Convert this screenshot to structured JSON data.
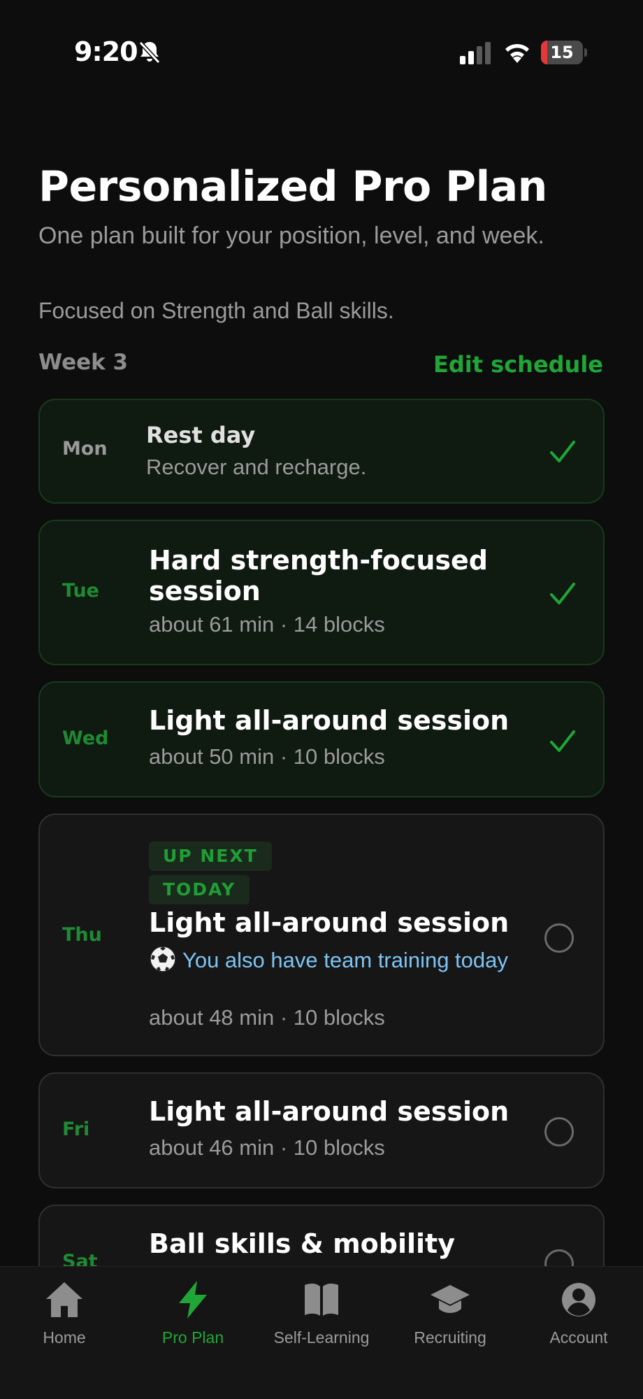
{
  "status_bar": {
    "time": "9:20",
    "battery_level": "15",
    "battery_fraction": 0.15
  },
  "header": {
    "title": "Personalized Pro Plan",
    "subtitle": "One plan built for your position, level, and week.",
    "focus": "Focused on Strength and Ball skills."
  },
  "week": {
    "label": "Week 3",
    "edit_label": "Edit schedule"
  },
  "days": [
    {
      "day": "Mon",
      "title": "Rest day",
      "meta": "Recover and recharge.",
      "status": "done"
    },
    {
      "day": "Tue",
      "title": "Hard strength-focused session",
      "meta": "about 61 min · 14 blocks",
      "status": "done"
    },
    {
      "day": "Wed",
      "title": "Light all-around session",
      "meta": "about 50 min · 10 blocks",
      "status": "done"
    },
    {
      "day": "Thu",
      "badges": [
        "UP NEXT",
        "TODAY"
      ],
      "title": "Light all-around session",
      "note": "You also have team training today",
      "meta": "about 48 min · 10 blocks",
      "status": "pending"
    },
    {
      "day": "Fri",
      "title": "Light all-around session",
      "meta": "about 46 min · 10 blocks",
      "status": "pending"
    },
    {
      "day": "Sat",
      "title": "Ball skills & mobility",
      "status": "pending"
    }
  ],
  "nav": {
    "items": [
      {
        "label": "Home",
        "icon": "home-icon"
      },
      {
        "label": "Pro Plan",
        "icon": "bolt-icon",
        "active": true
      },
      {
        "label": "Self-Learning",
        "icon": "book-icon"
      },
      {
        "label": "Recruiting",
        "icon": "graduation-cap-icon"
      },
      {
        "label": "Account",
        "icon": "account-icon"
      }
    ]
  },
  "colors": {
    "accent_green": "#1fa637",
    "note_blue": "#7dc4f5",
    "battery_red": "#e5383b"
  }
}
